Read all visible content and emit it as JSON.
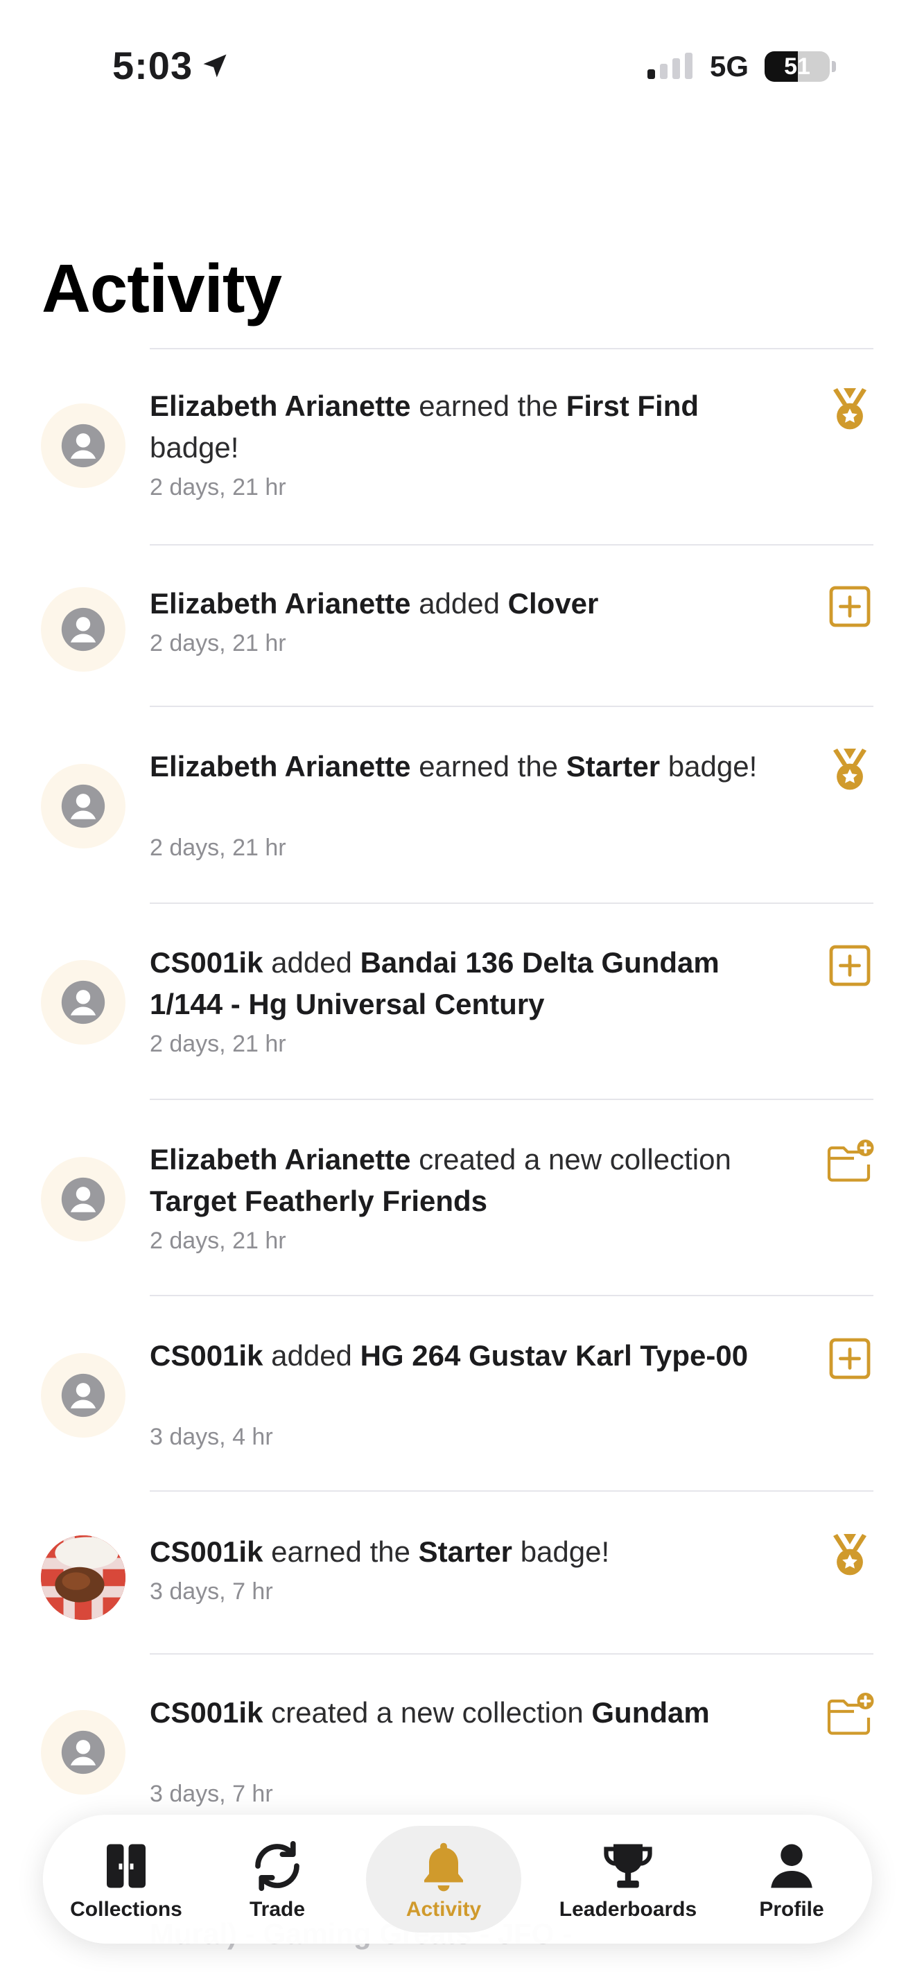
{
  "status_bar": {
    "time": "5:03",
    "network": "5G",
    "battery": "51",
    "signal_bars_active": 1,
    "signal_bars_total": 4
  },
  "header": {
    "title": "Activity"
  },
  "activities": [
    {
      "user": "Elizabeth Arianette",
      "action": " earned the ",
      "object": "First Find",
      "suffix": " badge!",
      "time": "2 days, 21 hr",
      "icon": "medal-icon",
      "avatar": "default"
    },
    {
      "user": "Elizabeth Arianette",
      "action": " added ",
      "object": "Clover",
      "suffix": "",
      "time": "2 days, 21 hr",
      "icon": "plus-square-icon",
      "avatar": "default"
    },
    {
      "user": "Elizabeth Arianette",
      "action": " earned the ",
      "object": "Starter",
      "suffix": " badge!",
      "time": "2 days, 21 hr",
      "icon": "medal-icon",
      "avatar": "default"
    },
    {
      "user": "CS001ik",
      "action": " added ",
      "object": "Bandai 136 Delta Gundam 1/144 - Hg Universal Century",
      "suffix": "",
      "time": "2 days, 21 hr",
      "icon": "plus-square-icon",
      "avatar": "default"
    },
    {
      "user": "Elizabeth Arianette",
      "action": " created a new collection ",
      "object": "Target Featherly Friends",
      "suffix": "",
      "time": "2 days, 21 hr",
      "icon": "folder-plus-icon",
      "avatar": "default"
    },
    {
      "user": "CS001ik",
      "action": " added ",
      "object": "HG 264 Gustav Karl Type-00",
      "suffix": "",
      "time": "3 days, 4 hr",
      "icon": "plus-square-icon",
      "avatar": "default"
    },
    {
      "user": "CS001ik",
      "action": " earned the ",
      "object": "Starter",
      "suffix": " badge!",
      "time": "3 days, 7 hr",
      "icon": "medal-icon",
      "avatar": "photo"
    },
    {
      "user": "CS001ik",
      "action": " created a new collection ",
      "object": "Gundam",
      "suffix": "",
      "time": "3 days, 7 hr",
      "icon": "folder-plus-icon",
      "avatar": "default"
    }
  ],
  "peek_text": "Mural) - Gaming Greats - JFO -",
  "tabs": [
    {
      "label": "Collections",
      "icon": "collections-icon",
      "active": false
    },
    {
      "label": "Trade",
      "icon": "trade-icon",
      "active": false
    },
    {
      "label": "Activity",
      "icon": "bell-icon",
      "active": true
    },
    {
      "label": "Leaderboards",
      "icon": "trophy-icon",
      "active": false
    },
    {
      "label": "Profile",
      "icon": "person-icon",
      "active": false
    }
  ],
  "colors": {
    "accent": "#D09A2C",
    "avatar_bg": "#FDF6EA",
    "divider": "#E5E5EA",
    "secondary_text": "#8E8E93"
  }
}
